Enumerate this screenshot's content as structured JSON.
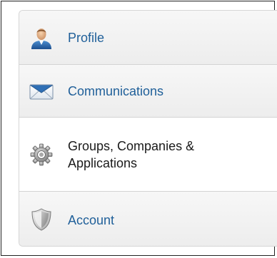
{
  "menu": {
    "items": [
      {
        "label": "Profile",
        "icon": "person-icon",
        "active": false
      },
      {
        "label": "Communications",
        "icon": "envelope-icon",
        "active": false
      },
      {
        "label": "Groups, Companies & Applications",
        "icon": "gear-icon",
        "active": true
      },
      {
        "label": "Account",
        "icon": "shield-icon",
        "active": false
      }
    ]
  },
  "colors": {
    "link": "#1f5f99",
    "active_text": "#1a1a1a",
    "border": "#d3d3d3"
  }
}
